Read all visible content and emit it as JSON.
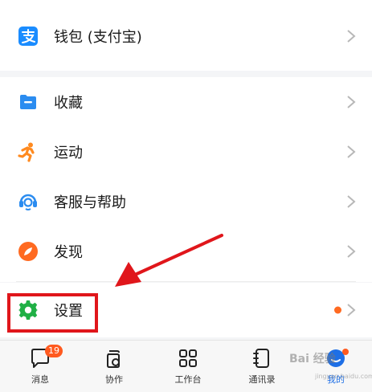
{
  "menu": {
    "wallet_label": "钱包 (支付宝)",
    "favorites_label": "收藏",
    "sports_label": "运动",
    "support_label": "客服与帮助",
    "discover_label": "发现",
    "settings_label": "设置"
  },
  "icons": {
    "wallet": "alipay-icon",
    "favorites": "folder-icon",
    "sports": "running-person-icon",
    "support": "headset-icon",
    "discover": "compass-icon",
    "settings": "gear-icon",
    "chevron": "chevron-right-icon"
  },
  "tabbar": {
    "messages_label": "消息",
    "messages_badge": "19",
    "collab_label": "协作",
    "workbench_label": "工作台",
    "contacts_label": "通讯录",
    "me_label": "我的"
  },
  "colors": {
    "wallet_icon": "#1a8cff",
    "favorites_icon": "#2b8cf0",
    "sports_icon": "#ff8a1f",
    "support_icon": "#2b8cf0",
    "discover_icon": "#ff6a21",
    "settings_icon": "#1fb045",
    "annotation_red": "#e0161b",
    "badge_orange": "#ff5a1f",
    "active_tab": "#1e6fe6"
  },
  "watermark": {
    "text": "Bai 经验",
    "sub": "jingyan.baidu.com"
  }
}
